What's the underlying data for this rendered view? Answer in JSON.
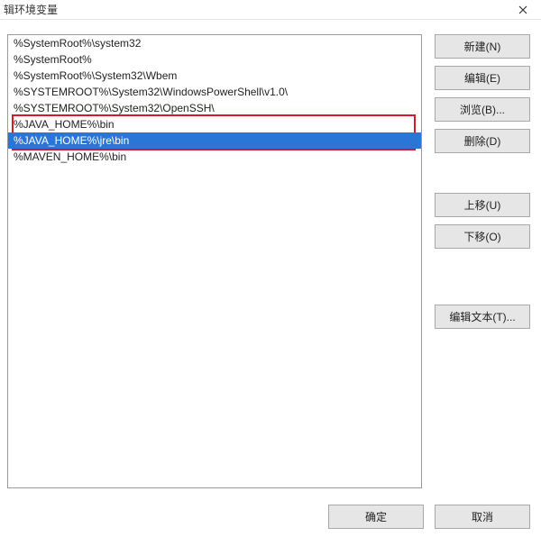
{
  "window": {
    "title": "辑环境变量"
  },
  "entries": [
    "%SystemRoot%\\system32",
    "%SystemRoot%",
    "%SystemRoot%\\System32\\Wbem",
    "%SYSTEMROOT%\\System32\\WindowsPowerShell\\v1.0\\",
    "%SYSTEMROOT%\\System32\\OpenSSH\\",
    "%JAVA_HOME%\\bin",
    "%JAVA_HOME%\\jre\\bin",
    "%MAVEN_HOME%\\bin"
  ],
  "selected_index": 6,
  "highlight_range": {
    "start": 5,
    "end": 6
  },
  "buttons": {
    "new": "新建(N)",
    "edit": "编辑(E)",
    "browse": "浏览(B)...",
    "delete": "删除(D)",
    "moveup": "上移(U)",
    "movedown": "下移(O)",
    "edittext": "编辑文本(T)...",
    "ok": "确定",
    "cancel": "取消"
  }
}
